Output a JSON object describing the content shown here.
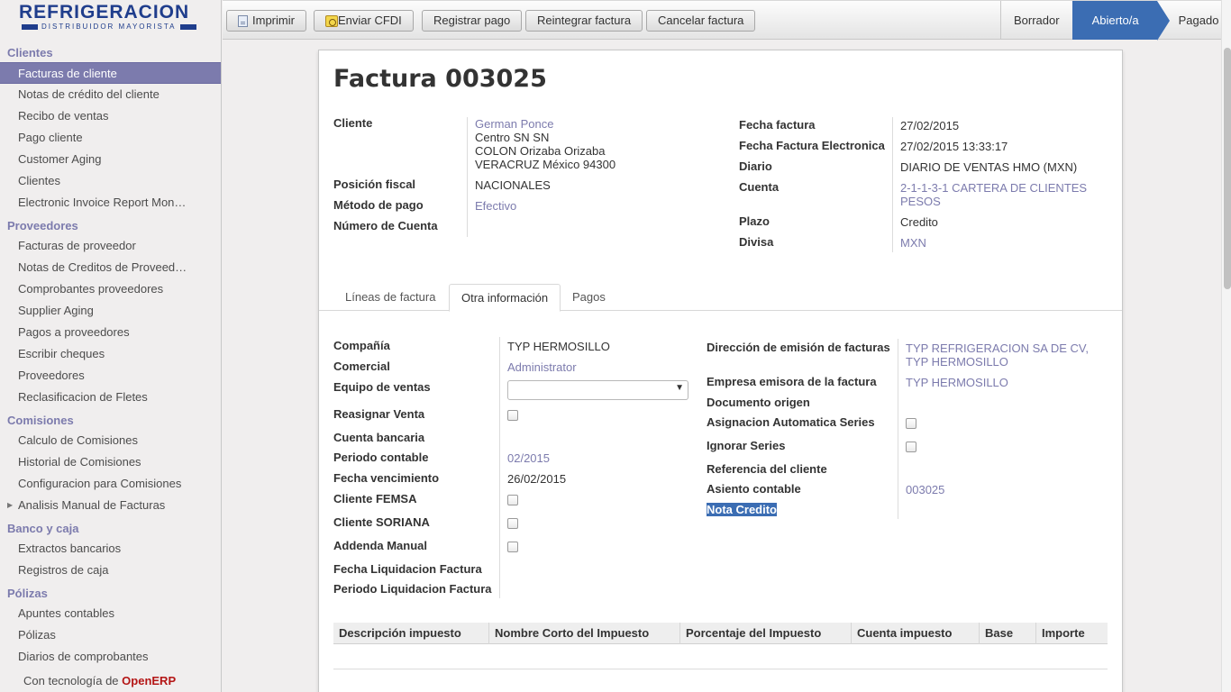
{
  "logo": {
    "brand": "REFRIGERACION",
    "tagline": "DISTRIBUIDOR MAYORISTA"
  },
  "sidebar": {
    "sections": [
      {
        "title": "Clientes",
        "items": [
          "Facturas de cliente",
          "Notas de crédito del cliente",
          "Recibo de ventas",
          "Pago cliente",
          "Customer Aging",
          "Clientes",
          "Electronic Invoice Report Mon…"
        ]
      },
      {
        "title": "Proveedores",
        "items": [
          "Facturas de proveedor",
          "Notas de Creditos de Proveed…",
          "Comprobantes proveedores",
          "Supplier Aging",
          "Pagos a proveedores",
          "Escribir cheques",
          "Proveedores",
          "Reclasificacion de Fletes"
        ]
      },
      {
        "title": "Comisiones",
        "items": [
          "Calculo de Comisiones",
          "Historial de Comisiones",
          "Configuracion para Comisiones",
          "Analisis Manual de Facturas"
        ]
      },
      {
        "title": "Banco y caja",
        "items": [
          "Extractos bancarios",
          "Registros de caja"
        ]
      },
      {
        "title": "Pólizas",
        "items": [
          "Apuntes contables",
          "Pólizas",
          "Diarios de comprobantes"
        ]
      }
    ],
    "active_item": "Facturas de cliente",
    "powered_prefix": "Con tecnología de",
    "powered_brand": "OpenERP"
  },
  "toolbar": {
    "print": "Imprimir",
    "send_cfdi": "Enviar CFDI",
    "register_payment": "Registrar pago",
    "refund": "Reintegrar factura",
    "cancel": "Cancelar factura"
  },
  "statusbar": {
    "draft": "Borrador",
    "open": "Abierto/a",
    "paid": "Pagado"
  },
  "form": {
    "title_prefix": "Factura",
    "number": "003025",
    "labels": {
      "cliente": "Cliente",
      "posicion": "Posición fiscal",
      "metodo": "Método de pago",
      "numero_cuenta": "Número de Cuenta",
      "fecha_factura": "Fecha factura",
      "fecha_electronica": "Fecha Factura Electronica",
      "diario": "Diario",
      "cuenta": "Cuenta",
      "plazo": "Plazo",
      "divisa": "Divisa"
    },
    "cliente_name": "German Ponce",
    "cliente_addr1": "Centro SN SN",
    "cliente_addr2": "COLON Orizaba Orizaba",
    "cliente_addr3": "VERACRUZ México 94300",
    "posicion_fiscal": "NACIONALES",
    "metodo_pago": "Efectivo",
    "fecha_factura": "27/02/2015",
    "fecha_electronica": "27/02/2015 13:33:17",
    "diario": "DIARIO DE VENTAS HMO (MXN)",
    "cuenta_l1": "2-1-1-3-1 CARTERA DE CLIENTES",
    "cuenta_l2": "PESOS",
    "plazo": "Credito",
    "divisa": "MXN"
  },
  "tabs": [
    "Líneas de factura",
    "Otra información",
    "Pagos"
  ],
  "other_info": {
    "labels": {
      "compania": "Compañía",
      "comercial": "Comercial",
      "equipo": "Equipo de ventas",
      "reasignar": "Reasignar Venta",
      "cuenta_bancaria": "Cuenta bancaria",
      "periodo": "Periodo contable",
      "vencimiento": "Fecha vencimiento",
      "femsa": "Cliente FEMSA",
      "soriana": "Cliente SORIANA",
      "addenda": "Addenda Manual",
      "liq_fecha": "Fecha Liquidacion Factura",
      "liq_periodo": "Periodo Liquidacion Factura",
      "direccion": "Dirección de emisión de facturas",
      "empresa": "Empresa emisora de la factura",
      "documento": "Documento origen",
      "asignacion": "Asignacion Automatica Series",
      "ignorar": "Ignorar Series",
      "referencia": "Referencia del cliente",
      "asiento": "Asiento contable",
      "nota": "Nota Credito"
    },
    "compania": "TYP HERMOSILLO",
    "comercial": "Administrator",
    "equipo_ventas": "",
    "periodo_contable": "02/2015",
    "fecha_vencimiento": "26/02/2015",
    "direccion_l1": "TYP REFRIGERACION SA DE CV,",
    "direccion_l2": "TYP HERMOSILLO",
    "empresa_emisora": "TYP HERMOSILLO",
    "asiento_contable": "003025"
  },
  "tax_table": {
    "columns": [
      "Descripción impuesto",
      "Nombre Corto del Impuesto",
      "Porcentaje del Impuesto",
      "Cuenta impuesto",
      "Base",
      "Importe"
    ]
  }
}
